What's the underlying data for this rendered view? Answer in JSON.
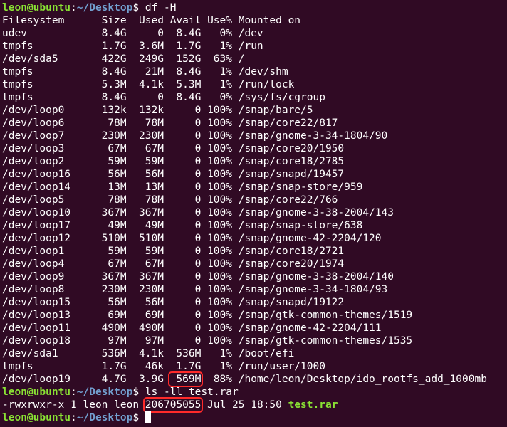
{
  "prompt": {
    "user": "leon@ubuntu",
    "colon": ":",
    "path": "~/Desktop",
    "dollar": "$ "
  },
  "commands": {
    "df": "df -H",
    "ls": "ls -ll test.rar",
    "last": ""
  },
  "df": {
    "header": "Filesystem      Size  Used Avail Use% Mounted on",
    "rows": [
      "udev            8.4G     0  8.4G   0% /dev",
      "tmpfs           1.7G  3.6M  1.7G   1% /run",
      "/dev/sda5       422G  249G  152G  63% /",
      "tmpfs           8.4G   21M  8.4G   1% /dev/shm",
      "tmpfs           5.3M  4.1k  5.3M   1% /run/lock",
      "tmpfs           8.4G     0  8.4G   0% /sys/fs/cgroup",
      "/dev/loop0      132k  132k     0 100% /snap/bare/5",
      "/dev/loop6       78M   78M     0 100% /snap/core22/817",
      "/dev/loop7      230M  230M     0 100% /snap/gnome-3-34-1804/90",
      "/dev/loop3       67M   67M     0 100% /snap/core20/1950",
      "/dev/loop2       59M   59M     0 100% /snap/core18/2785",
      "/dev/loop16      56M   56M     0 100% /snap/snapd/19457",
      "/dev/loop14      13M   13M     0 100% /snap/snap-store/959",
      "/dev/loop5       78M   78M     0 100% /snap/core22/766",
      "/dev/loop10     367M  367M     0 100% /snap/gnome-3-38-2004/143",
      "/dev/loop17      49M   49M     0 100% /snap/snap-store/638",
      "/dev/loop12     510M  510M     0 100% /snap/gnome-42-2204/120",
      "/dev/loop1       59M   59M     0 100% /snap/core18/2721",
      "/dev/loop4       67M   67M     0 100% /snap/core20/1974",
      "/dev/loop9      367M  367M     0 100% /snap/gnome-3-38-2004/140",
      "/dev/loop8      230M  230M     0 100% /snap/gnome-3-34-1804/93",
      "/dev/loop15      56M   56M     0 100% /snap/snapd/19122",
      "/dev/loop13      69M   69M     0 100% /snap/gtk-common-themes/1519",
      "/dev/loop11     490M  490M     0 100% /snap/gnome-42-2204/111",
      "/dev/loop18      97M   97M     0 100% /snap/gtk-common-themes/1535",
      "/dev/sda1       536M  4.1k  536M   1% /boot/efi",
      "tmpfs           1.7G   46k  1.7G   1% /run/user/1000"
    ],
    "last_row": {
      "pre": "/dev/loop19     4.7G  3.9G ",
      "avail": " 569M",
      "post": "  88% /home/leon/Desktop/ido_rootfs_add_1000mb"
    }
  },
  "ls": {
    "pre": "-rwxrwxr-x 1 leon leon ",
    "size": "206705055",
    "mid": " Jul 25 18:50 ",
    "name": "test.rar"
  },
  "colors": {
    "background": "#300a24",
    "prompt_user": "#8ae234",
    "prompt_path": "#729fcf",
    "highlight": "#ff2a2a"
  }
}
